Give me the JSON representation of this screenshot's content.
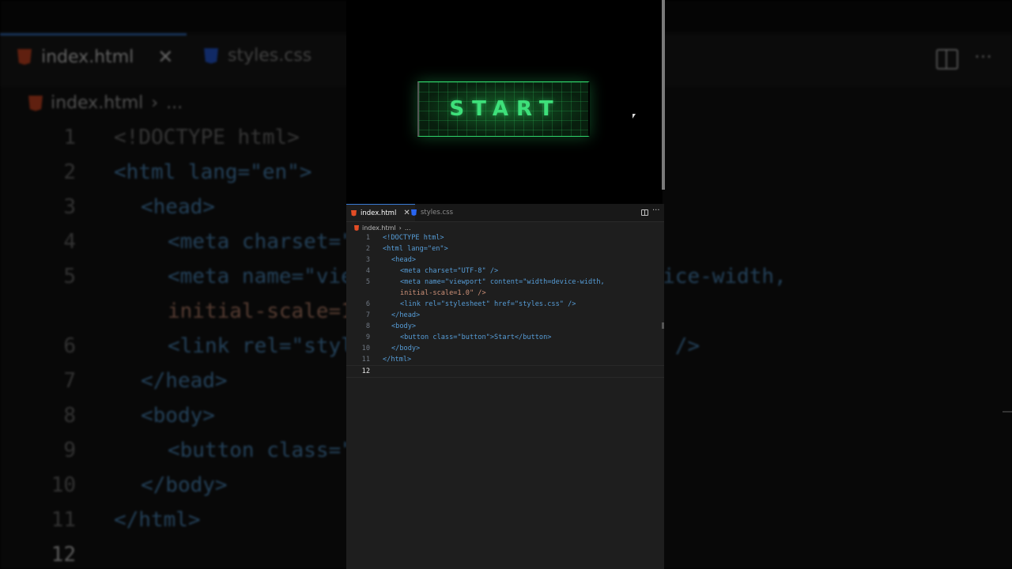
{
  "editor": {
    "tabs": [
      {
        "label": "index.html",
        "active": true,
        "icon": "html5-icon"
      },
      {
        "label": "styles.css",
        "active": false,
        "icon": "css3-icon"
      }
    ],
    "close_glyph": "✕",
    "more_glyph": "···",
    "breadcrumb": {
      "file": "index.html",
      "separator": "›",
      "rest": "..."
    },
    "current_line": 12
  },
  "preview": {
    "button_label": "Start"
  },
  "code_lines": [
    {
      "n": "1",
      "text": "<!DOCTYPE html>"
    },
    {
      "n": "2",
      "text": "<html lang=\"en\">"
    },
    {
      "n": "3",
      "text": "<head>"
    },
    {
      "n": "4",
      "text": "<meta charset=\"UTF-8\" />"
    },
    {
      "n": "5",
      "text": "<meta name=\"viewport\" content=\"width=device-width,"
    },
    {
      "n": "",
      "text": "initial-scale=1.0\" />"
    },
    {
      "n": "6",
      "text": "<link rel=\"stylesheet\" href=\"styles.css\" />"
    },
    {
      "n": "7",
      "text": "</head>"
    },
    {
      "n": "8",
      "text": "<body>"
    },
    {
      "n": "9",
      "text": "<button class=\"button\">Start</button>"
    },
    {
      "n": "10",
      "text": "</body>"
    },
    {
      "n": "11",
      "text": "</html>"
    },
    {
      "n": "12",
      "text": ""
    }
  ],
  "colors": {
    "accent": "#3a7bd5",
    "button_green": "#3ee07a",
    "tag": "#569cd6",
    "attr": "#9cdcfe",
    "string": "#ce9178"
  }
}
